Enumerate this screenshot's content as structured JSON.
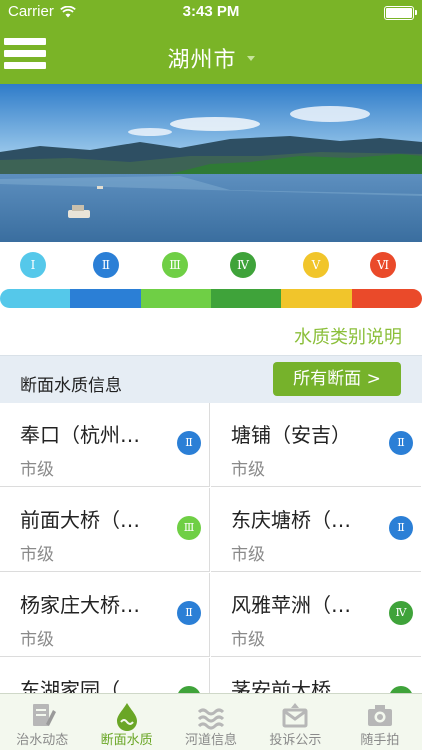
{
  "status": {
    "carrier": "Carrier",
    "time": "3:43 PM"
  },
  "nav": {
    "title": "湖州市"
  },
  "water_classes": [
    {
      "label": "Ⅰ",
      "color": "#55c8ea"
    },
    {
      "label": "Ⅱ",
      "color": "#2b7fd6"
    },
    {
      "label": "Ⅲ",
      "color": "#6fcf45"
    },
    {
      "label": "Ⅳ",
      "color": "#3fa33a"
    },
    {
      "label": "Ⅴ",
      "color": "#f1c52b"
    },
    {
      "label": "Ⅵ",
      "color": "#ea4a2a"
    }
  ],
  "explain_link": "水质类别说明",
  "section": {
    "title": "断面水质信息",
    "all_button": "所有断面 >"
  },
  "sites": [
    {
      "name": "奉口（杭州…",
      "level": "市级",
      "class": "Ⅱ",
      "color": "#2b7fd6"
    },
    {
      "name": "塘铺（安吉）",
      "level": "市级",
      "class": "Ⅱ",
      "color": "#2b7fd6"
    },
    {
      "name": "前面大桥（…",
      "level": "市级",
      "class": "Ⅲ",
      "color": "#6fcf45"
    },
    {
      "name": "东庆塘桥（…",
      "level": "市级",
      "class": "Ⅱ",
      "color": "#2b7fd6"
    },
    {
      "name": "杨家庄大桥…",
      "level": "市级",
      "class": "Ⅱ",
      "color": "#2b7fd6"
    },
    {
      "name": "风雅苹洲（…",
      "level": "市级",
      "class": "Ⅳ",
      "color": "#3fa33a"
    },
    {
      "name": "东湖家园（",
      "level": "",
      "class": "",
      "color": "#3fa33a"
    },
    {
      "name": "茅安前大桥",
      "level": "",
      "class": "",
      "color": "#3fa33a"
    }
  ],
  "tabs": [
    {
      "label": "治水动态",
      "icon": "document-pen-icon"
    },
    {
      "label": "断面水质",
      "icon": "water-drop-icon"
    },
    {
      "label": "河道信息",
      "icon": "river-waves-icon"
    },
    {
      "label": "投诉公示",
      "icon": "complaint-envelope-icon"
    },
    {
      "label": "随手拍",
      "icon": "camera-icon"
    }
  ]
}
